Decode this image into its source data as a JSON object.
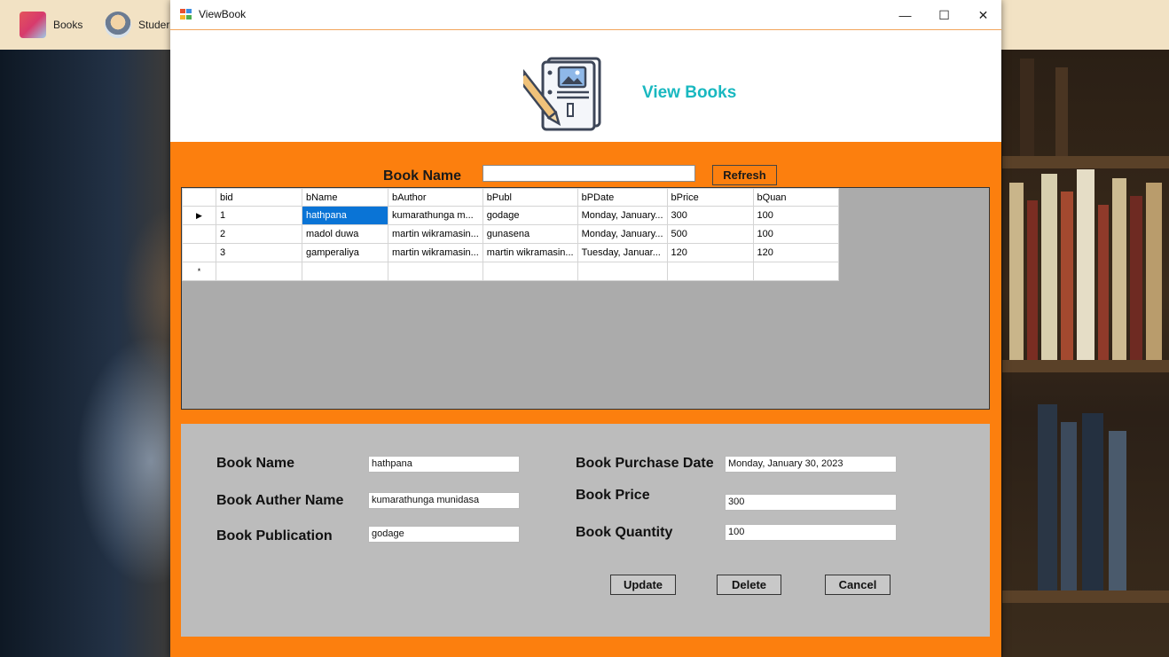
{
  "taskbar": {
    "items": [
      {
        "label": "Books",
        "icon": "books-icon"
      },
      {
        "label": "Studer",
        "icon": "student-icon"
      }
    ]
  },
  "window": {
    "title": "ViewBook",
    "controls": {
      "minimize": "—",
      "maximize": "☐",
      "close": "✕"
    }
  },
  "header": {
    "title": "View Books",
    "icon": "book-edit-icon",
    "title_color": "#19b8c0"
  },
  "search": {
    "label": "Book Name",
    "value": "",
    "refresh_label": "Refresh"
  },
  "grid": {
    "columns": [
      "bid",
      "bName",
      "bAuthor",
      "bPubl",
      "bPDate",
      "bPrice",
      "bQuan"
    ],
    "rows": [
      [
        "1",
        "hathpana",
        "kumarathunga m...",
        "godage",
        "Monday, January...",
        "300",
        "100"
      ],
      [
        "2",
        "madol duwa",
        "martin wikramasin...",
        "gunasena",
        "Monday, January...",
        "500",
        "100"
      ],
      [
        "3",
        "gamperaliya",
        "martin wikramasin...",
        "martin wikramasin...",
        "Tuesday, Januar...",
        "120",
        "120"
      ]
    ],
    "current_row_marker": "▶",
    "new_row_marker": "*",
    "selected_cell": {
      "row": 0,
      "column": "bName"
    }
  },
  "form": {
    "book_name_label": "Book Name",
    "book_name_value": "hathpana",
    "author_label": "Book Auther Name",
    "author_value": "kumarathunga munidasa",
    "publication_label": "Book Publication",
    "publication_value": "godage",
    "purchase_date_label": "Book Purchase Date",
    "purchase_date_value": "Monday, January 30, 2023",
    "price_label": "Book Price",
    "price_value": "300",
    "quantity_label": "Book Quantity",
    "quantity_value": "100"
  },
  "actions": {
    "update": "Update",
    "delete": "Delete",
    "cancel": "Cancel"
  },
  "colors": {
    "accent_orange": "#fc7f0e",
    "selection_blue": "#0a74d6",
    "form_gray": "#bcbcbc",
    "grid_bg_gray": "#ababab"
  }
}
